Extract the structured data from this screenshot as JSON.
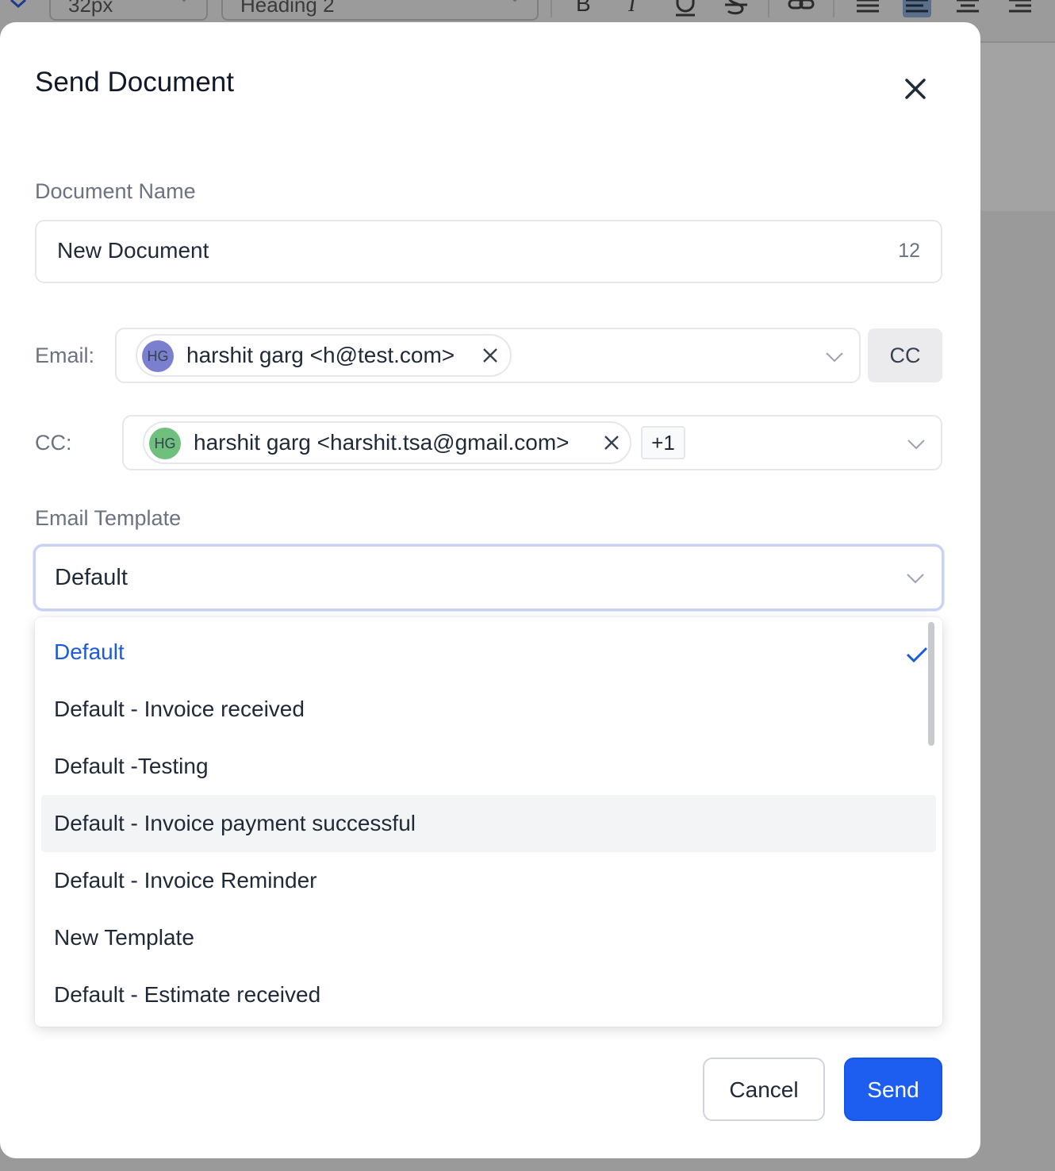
{
  "toolbar": {
    "font_size": "32px",
    "block_type": "Heading 2",
    "bold_label": "B",
    "italic_label": "I",
    "underline_label": "U",
    "strike_label": "S"
  },
  "modal": {
    "title": "Send Document",
    "document_name_label": "Document Name",
    "document_name_value": "New Document",
    "document_name_count": "12",
    "email_label": "Email:",
    "email_chip": {
      "initials": "HG",
      "text": "harshit garg <h@test.com>",
      "avatar_color": "#7b7fd0"
    },
    "cc_button": "CC",
    "cc_label": "CC:",
    "cc_chip": {
      "initials": "HG",
      "text": "harshit garg <harshit.tsa@gmail.com>",
      "avatar_color": "#6fbf7d"
    },
    "cc_more": "+1",
    "template_label": "Email Template",
    "template_value": "Default",
    "template_options": [
      "Default",
      "Default - Invoice received",
      "Default -Testing",
      "Default - Invoice payment successful",
      "Default - Invoice Reminder",
      "New Template",
      "Default - Estimate received"
    ],
    "cancel_label": "Cancel",
    "send_label": "Send"
  },
  "colors": {
    "accent": "#1d5ef0",
    "selected_text": "#1d5bd8",
    "hover_row": "#f3f4f6"
  }
}
